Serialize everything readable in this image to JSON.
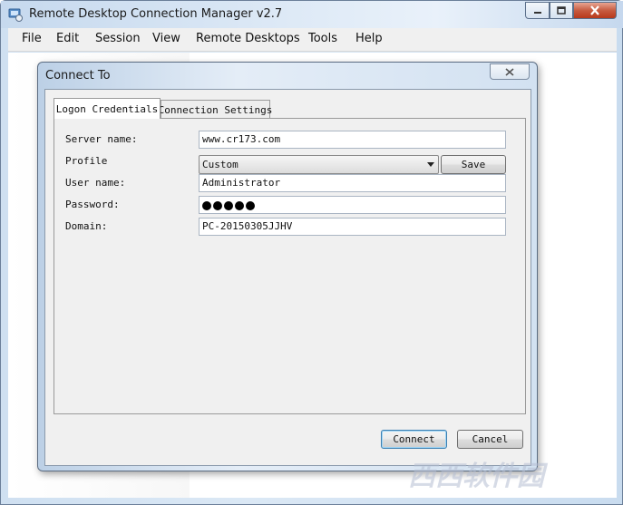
{
  "window": {
    "title": "Remote Desktop Connection Manager v2.7"
  },
  "menu": {
    "items": [
      "File",
      "Edit",
      "Session",
      "View",
      "Remote Desktops",
      "Tools",
      "Help"
    ]
  },
  "dialog": {
    "title": "Connect To",
    "tabs": [
      "Logon Credentials",
      "Connection Settings"
    ],
    "active_tab": "Logon Credentials",
    "fields": {
      "server_name": {
        "label": "Server name:",
        "value": "www.cr173.com"
      },
      "profile": {
        "label": "Profile",
        "value": "Custom"
      },
      "user_name": {
        "label": "User name:",
        "value": "Administrator"
      },
      "password": {
        "label": "Password:",
        "masked_length": 5
      },
      "domain": {
        "label": "Domain:",
        "value": "PC-20150305JJHV"
      }
    },
    "save_label": "Save",
    "connect_label": "Connect",
    "cancel_label": "Cancel"
  },
  "watermark": {
    "text": "西西软件园"
  }
}
